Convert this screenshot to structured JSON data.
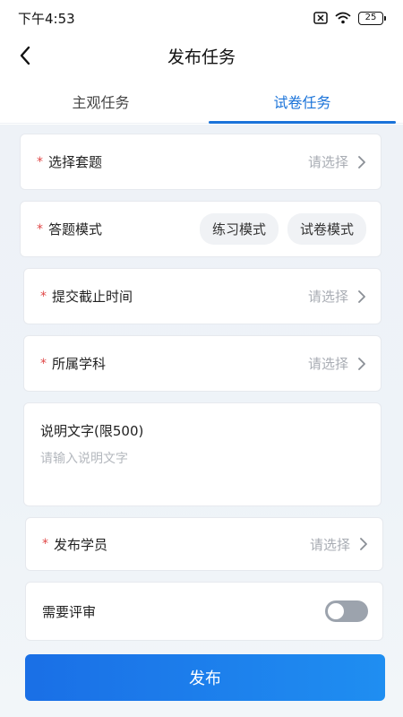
{
  "status_bar": {
    "time": "下午4:53",
    "battery": "25"
  },
  "nav": {
    "title": "发布任务",
    "back_icon": "chevron-left-icon"
  },
  "tabs": [
    {
      "label": "主观任务",
      "active": false
    },
    {
      "label": "试卷任务",
      "active": true
    }
  ],
  "form": {
    "select_set": {
      "label": "选择套题",
      "required": true,
      "value": "请选择"
    },
    "answer_mode": {
      "label": "答题模式",
      "required": true,
      "options": [
        "练习模式",
        "试卷模式"
      ]
    },
    "deadline": {
      "label": "提交截止时间",
      "required": true,
      "value": "请选择"
    },
    "subject": {
      "label": "所属学科",
      "required": true,
      "value": "请选择"
    },
    "description": {
      "label": "说明文字(限500)",
      "placeholder": "请输入说明文字",
      "value": ""
    },
    "students": {
      "label": "发布学员",
      "required": true,
      "value": "请选择"
    },
    "review": {
      "label": "需要评审",
      "enabled": false
    }
  },
  "required_mark": "*",
  "publish_label": "发布",
  "colors": {
    "accent": "#1a73d9",
    "required": "#e04848",
    "placeholder": "#a9adb4",
    "toggle_off": "#9ca3ad"
  }
}
